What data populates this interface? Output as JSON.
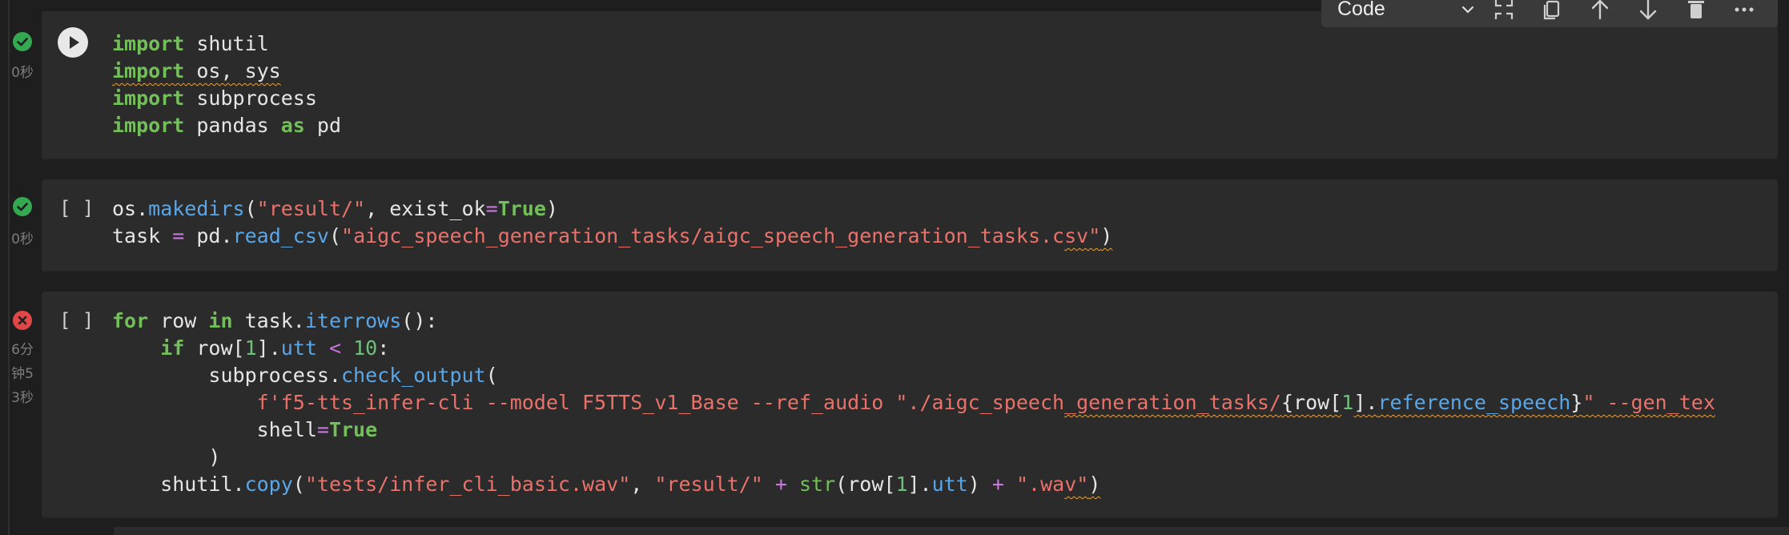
{
  "toolbar": {
    "cell_type": "Code",
    "icons": [
      "collapse-icon",
      "copy-icon",
      "move-up-icon",
      "move-down-icon",
      "delete-icon",
      "more-icon"
    ]
  },
  "cells": [
    {
      "status": "success",
      "elapsed": "0秒",
      "exec_count": "",
      "lines": [
        [
          [
            "kw",
            "import"
          ],
          [
            "t",
            " shutil"
          ]
        ],
        [
          [
            "kwsq",
            "import"
          ],
          [
            "sq",
            " os, sys"
          ]
        ],
        [
          [
            "kw",
            "import"
          ],
          [
            "t",
            " subprocess"
          ]
        ],
        [
          [
            "kw",
            "import"
          ],
          [
            "t",
            " pandas "
          ],
          [
            "kw",
            "as"
          ],
          [
            "t",
            " pd"
          ]
        ]
      ]
    },
    {
      "status": "success",
      "elapsed": "0秒",
      "exec_count": "[ ]",
      "lines": [
        [
          [
            "t",
            "os."
          ],
          [
            "fn",
            "makedirs"
          ],
          [
            "t",
            "("
          ],
          [
            "str",
            "\"result/\""
          ],
          [
            "t",
            ", exist_ok"
          ],
          [
            "op",
            "="
          ],
          [
            "bool",
            "True"
          ],
          [
            "t",
            ")"
          ]
        ],
        [
          [
            "t",
            "task "
          ],
          [
            "op",
            "="
          ],
          [
            "t",
            " pd."
          ],
          [
            "fn",
            "read_csv"
          ],
          [
            "t",
            "("
          ],
          [
            "str",
            "\"aigc_speech_generation_tasks/aigc_speech_generation_tasks.c"
          ],
          [
            "strsq",
            "sv\""
          ],
          [
            "sq",
            ")"
          ]
        ]
      ]
    },
    {
      "status": "error",
      "elapsed": "6分钟53秒",
      "elapsed_lines": [
        "6分",
        "钟5",
        "3秒"
      ],
      "exec_count": "[ ]",
      "lines": [
        [
          [
            "kw",
            "for"
          ],
          [
            "t",
            " row "
          ],
          [
            "kw",
            "in"
          ],
          [
            "t",
            " task."
          ],
          [
            "fn",
            "iterrows"
          ],
          [
            "t",
            "():"
          ]
        ],
        [
          [
            "t",
            "    "
          ],
          [
            "kw",
            "if"
          ],
          [
            "t",
            " row["
          ],
          [
            "num",
            "1"
          ],
          [
            "t",
            "]."
          ],
          [
            "fn",
            "utt"
          ],
          [
            "t",
            " "
          ],
          [
            "op",
            "<"
          ],
          [
            "t",
            " "
          ],
          [
            "num",
            "10"
          ],
          [
            "t",
            ":"
          ]
        ],
        [
          [
            "t",
            "        subprocess."
          ],
          [
            "fn",
            "check_output"
          ],
          [
            "t",
            "("
          ]
        ],
        [
          [
            "t",
            "            "
          ],
          [
            "str",
            "f'f5-tts_infer-cli --model F5TTS_v1_Base --ref_audio \"./aigc_speech"
          ],
          [
            "strsq",
            "_generation_tasks/"
          ],
          [
            "sq",
            "{row["
          ],
          [
            "num",
            "1"
          ],
          [
            "sq",
            "]."
          ],
          [
            "fnsq",
            "reference_speech"
          ],
          [
            "sq",
            "}"
          ],
          [
            "strsq",
            "\" --gen_tex"
          ]
        ],
        [
          [
            "t",
            "            shell"
          ],
          [
            "op",
            "="
          ],
          [
            "bool",
            "True"
          ]
        ],
        [
          [
            "t",
            "        )"
          ]
        ],
        [
          [
            "t",
            "    shutil."
          ],
          [
            "fn",
            "copy"
          ],
          [
            "t",
            "("
          ],
          [
            "str",
            "\"tests/infer_cli_basic.wav\""
          ],
          [
            "t",
            ", "
          ],
          [
            "str",
            "\"result/\""
          ],
          [
            "t",
            " "
          ],
          [
            "op",
            "+"
          ],
          [
            "t",
            " "
          ],
          [
            "bi",
            "str"
          ],
          [
            "t",
            "(row["
          ],
          [
            "num",
            "1"
          ],
          [
            "t",
            "]."
          ],
          [
            "fn",
            "utt"
          ],
          [
            "t",
            ") "
          ],
          [
            "op",
            "+"
          ],
          [
            "t",
            " "
          ],
          [
            "str",
            "\".wa"
          ],
          [
            "strsq",
            "v\""
          ],
          [
            "sq",
            ")"
          ]
        ]
      ]
    }
  ]
}
